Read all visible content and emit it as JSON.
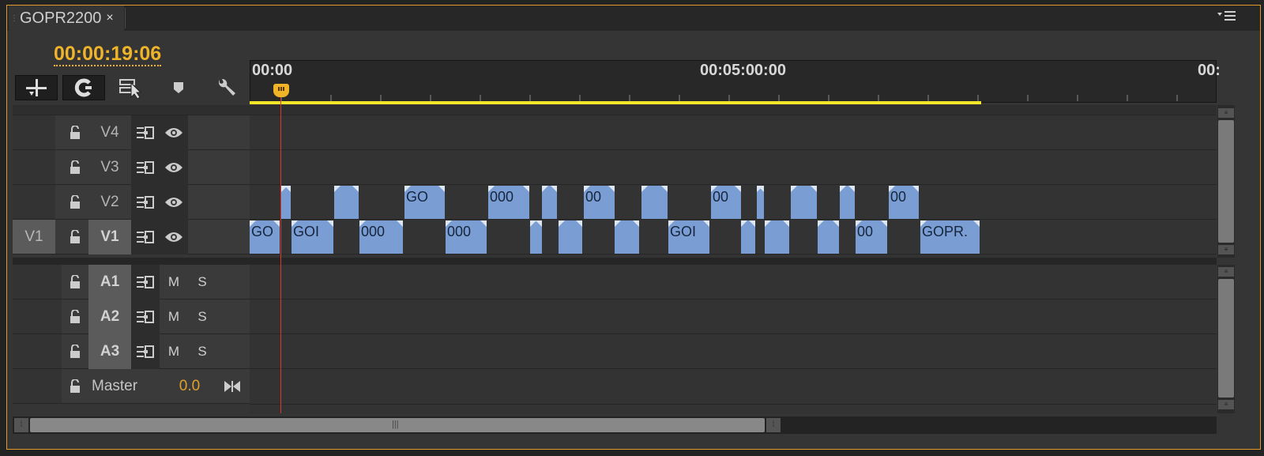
{
  "tab": {
    "title": "GOPR2200",
    "close": "×"
  },
  "timecode": "00:00:19:06",
  "ruler": {
    "labels": [
      "00:00",
      "00:05:00:00",
      "00:"
    ]
  },
  "icons": {
    "insert": "insert-edit-icon",
    "snap": "snap-magnet-icon",
    "linked": "linked-selection-icon",
    "marker": "add-marker-icon",
    "settings": "wrench-icon",
    "lock": "lock-icon",
    "sync": "sync-lock-icon",
    "eye": "eye-icon",
    "pan": "pan-balance-icon",
    "menu": "panel-menu-icon"
  },
  "video_tracks": [
    {
      "name": "V4",
      "source": "",
      "clips": []
    },
    {
      "name": "V3",
      "source": "",
      "clips": []
    },
    {
      "name": "V2",
      "source": "",
      "clips": [
        {
          "label": ""
        },
        {
          "label": ""
        },
        {
          "label": "GO"
        },
        {
          "label": "000"
        },
        {
          "label": ""
        },
        {
          "label": "00"
        },
        {
          "label": ""
        },
        {
          "label": "00"
        },
        {
          "label": ""
        },
        {
          "label": ""
        },
        {
          "label": ""
        },
        {
          "label": "00"
        }
      ]
    },
    {
      "name": "V1",
      "source": "V1",
      "clips": [
        {
          "label": "GO"
        },
        {
          "label": "GOI"
        },
        {
          "label": "000"
        },
        {
          "label": "000"
        },
        {
          "label": ""
        },
        {
          "label": ""
        },
        {
          "label": ""
        },
        {
          "label": "GOI"
        },
        {
          "label": ""
        },
        {
          "label": ""
        },
        {
          "label": ""
        },
        {
          "label": "00"
        },
        {
          "label": "GOPR."
        }
      ]
    }
  ],
  "audio_tracks": [
    {
      "name": "A1",
      "mute": "M",
      "solo": "S"
    },
    {
      "name": "A2",
      "mute": "M",
      "solo": "S"
    },
    {
      "name": "A3",
      "mute": "M",
      "solo": "S"
    }
  ],
  "master": {
    "label": "Master",
    "value": "0.0"
  },
  "colors": {
    "accent": "#f0b429",
    "clip": "#7a9ed3",
    "playhead": "#e0352b",
    "workarea": "#f3e628"
  }
}
